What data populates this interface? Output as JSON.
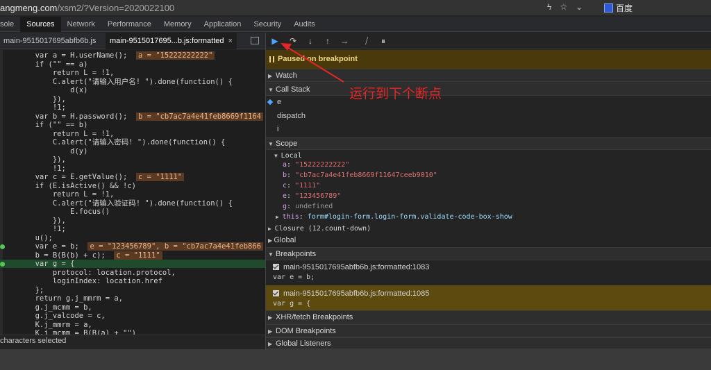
{
  "address_bar": {
    "url_host": "angmeng.com",
    "url_path": "/xsm2/?Version=2020022100",
    "bookmark_label": "百度",
    "icons": [
      "bolt-icon",
      "star-icon",
      "chevron-down-icon"
    ]
  },
  "devtools_tabs": [
    {
      "label": "sole",
      "active": false
    },
    {
      "label": "Sources",
      "active": true
    },
    {
      "label": "Network",
      "active": false
    },
    {
      "label": "Performance",
      "active": false
    },
    {
      "label": "Memory",
      "active": false
    },
    {
      "label": "Application",
      "active": false
    },
    {
      "label": "Security",
      "active": false
    },
    {
      "label": "Audits",
      "active": false
    }
  ],
  "file_tabs": [
    {
      "label": "main-9515017695abfb6b.js",
      "active": false
    },
    {
      "label": "main-9515017695...b.js:formatted",
      "active": true,
      "close": "×"
    }
  ],
  "code_lines": [
    {
      "text": "        var a = H.userName();",
      "inline": "a = \"15222222222\""
    },
    {
      "text": "        if (\"\" == a)"
    },
    {
      "text": "            return L = !1,"
    },
    {
      "text": "            C.alert(\"请输入用户名! \").done(function() {"
    },
    {
      "text": "                d(x)"
    },
    {
      "text": "            }),"
    },
    {
      "text": "            !1;"
    },
    {
      "text": "        var b = H.password();",
      "inline": "b = \"cb7ac7a4e41feb8669f1164"
    },
    {
      "text": "        if (\"\" == b)"
    },
    {
      "text": "            return L = !1,"
    },
    {
      "text": "            C.alert(\"请输入密码! \").done(function() {"
    },
    {
      "text": "                d(y)"
    },
    {
      "text": "            }),"
    },
    {
      "text": "            !1;"
    },
    {
      "text": "        var c = E.getValue();",
      "inline": "c = \"1111\""
    },
    {
      "text": "        if (E.isActive() && !c)"
    },
    {
      "text": "            return L = !1,"
    },
    {
      "text": "            C.alert(\"请输入验证码! \").done(function() {"
    },
    {
      "text": "                E.focus()"
    },
    {
      "text": "            }),"
    },
    {
      "text": "            !1;"
    },
    {
      "text": "        u();"
    },
    {
      "text": "        var e = b;",
      "inline": "e = \"123456789\", b = \"cb7ac7a4e41feb866",
      "breakpoint": true
    },
    {
      "text": "        b = B(B(b) + c);",
      "inline": "c = \"1111\""
    },
    {
      "text": "        var g = {",
      "highlight": true,
      "breakpoint": true
    },
    {
      "text": "            protocol: location.protocol,"
    },
    {
      "text": "            loginIndex: location.href"
    },
    {
      "text": "        };"
    },
    {
      "text": "        return g.j_mmrm = a,"
    },
    {
      "text": "        g.j_mcmm = b,"
    },
    {
      "text": "        g.j_valcode = c,"
    },
    {
      "text": "        K.j_mmrm = a,"
    },
    {
      "text": "        K.j_mcmm = B(B(a) + \"\")"
    }
  ],
  "status_bar": "characters selected",
  "debugger": {
    "toolbar_icons": [
      "resume-icon",
      "step-over-icon",
      "step-into-icon",
      "step-out-icon",
      "step-icon",
      "deactivate-breakpoints-icon",
      "pause-exceptions-icon"
    ],
    "paused_message": "Paused on breakpoint",
    "watch_label": "Watch",
    "call_stack_label": "Call Stack",
    "call_stack": [
      "e",
      "dispatch",
      "i"
    ],
    "scope_label": "Scope",
    "local_label": "Local",
    "locals": [
      {
        "key": "a",
        "value": "\"15222222222\"",
        "type": "string"
      },
      {
        "key": "b",
        "value": "\"cb7ac7a4e41feb8669f11647ceeb9010\"",
        "type": "string"
      },
      {
        "key": "c",
        "value": "\"1111\"",
        "type": "string"
      },
      {
        "key": "e",
        "value": "\"123456789\"",
        "type": "string"
      },
      {
        "key": "g",
        "value": "undefined",
        "type": "undefined"
      }
    ],
    "this_entry": {
      "key": "this",
      "value": "form#login-form.login-form.validate-code-box-show"
    },
    "closure_label": "Closure (12.count-down)",
    "global_label": "Global",
    "breakpoints_label": "Breakpoints",
    "breakpoints": [
      {
        "location": "main-9515017695abfb6b.js:formatted:1083",
        "code": "var e = b;",
        "active": false
      },
      {
        "location": "main-9515017695abfb6b.js:formatted:1085",
        "code": "var g = {",
        "active": true
      }
    ],
    "xhr_label": "XHR/fetch Breakpoints",
    "dom_label": "DOM Breakpoints",
    "listeners_label": "Global Listeners"
  },
  "annotation": {
    "text": "运行到下个断点",
    "color": "#e42626"
  }
}
